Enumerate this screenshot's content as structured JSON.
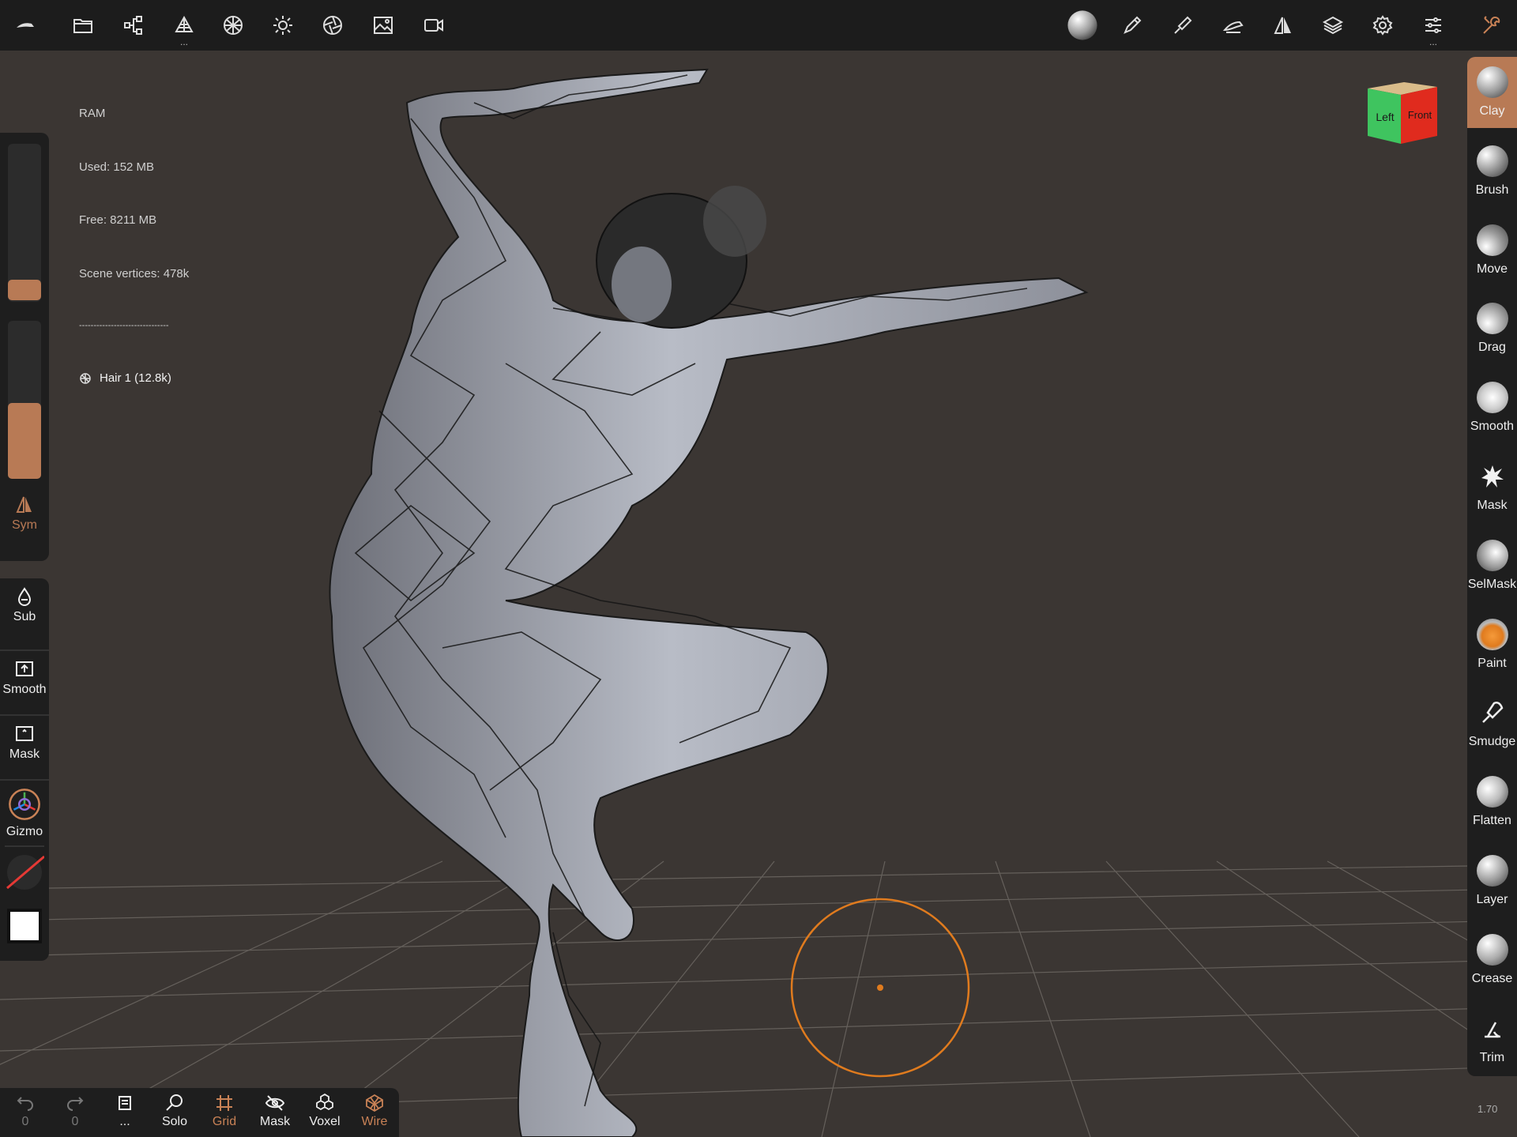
{
  "app": {
    "name": "Nomad Sculpt",
    "version_label": "1.70"
  },
  "colors": {
    "accent": "#b87a55",
    "brush_ring": "#e07b1e",
    "panel": "#1e1e1e",
    "background": "#3b3633"
  },
  "topbar": {
    "left_icons": [
      "nomad-logo-icon",
      "folder-icon",
      "scene-graph-icon",
      "topology-icon",
      "material-sphere-icon",
      "light-icon",
      "camera-icon",
      "background-image-icon",
      "video-icon"
    ],
    "right_icons": [
      "matcap-ball-icon",
      "stroke-icon",
      "painting-icon",
      "tools-icon",
      "symmetry-icon",
      "layers-icon",
      "settings-icon",
      "interface-sliders-icon",
      "tool-wrench-icon"
    ]
  },
  "stats": {
    "ram_label": "RAM",
    "used": "Used: 152 MB",
    "free": "Free: 8211 MB",
    "vertices": "Scene vertices: 478k",
    "separator": "-------------------------------",
    "object": "Hair 1 (12.8k)"
  },
  "left_panel": {
    "sym_label": "Sym",
    "radius_value": 0.08,
    "intensity_value": 0.47,
    "buttons": [
      {
        "label": "Sub",
        "icon": "droplet-icon"
      },
      {
        "label": "Smooth",
        "icon": "smooth-upload-icon"
      },
      {
        "label": "Mask",
        "icon": "mask-square-icon"
      },
      {
        "label": "Gizmo",
        "icon": "gizmo-icon"
      }
    ]
  },
  "tools": [
    {
      "label": "Clay",
      "active": true
    },
    {
      "label": "Brush",
      "active": false
    },
    {
      "label": "Move",
      "active": false
    },
    {
      "label": "Drag",
      "active": false
    },
    {
      "label": "Smooth",
      "active": false
    },
    {
      "label": "Mask",
      "active": false
    },
    {
      "label": "SelMask",
      "active": false
    },
    {
      "label": "Paint",
      "active": false
    },
    {
      "label": "Smudge",
      "active": false
    },
    {
      "label": "Flatten",
      "active": false
    },
    {
      "label": "Layer",
      "active": false
    },
    {
      "label": "Crease",
      "active": false
    },
    {
      "label": "Trim",
      "active": false
    }
  ],
  "view_cube": {
    "left_label": "Left",
    "front_label": "Front"
  },
  "bottom_bar": {
    "undo_count": "0",
    "redo_count": "0",
    "more_label": "...",
    "solo": "Solo",
    "grid": "Grid",
    "mask": "Mask",
    "voxel": "Voxel",
    "wire": "Wire"
  }
}
